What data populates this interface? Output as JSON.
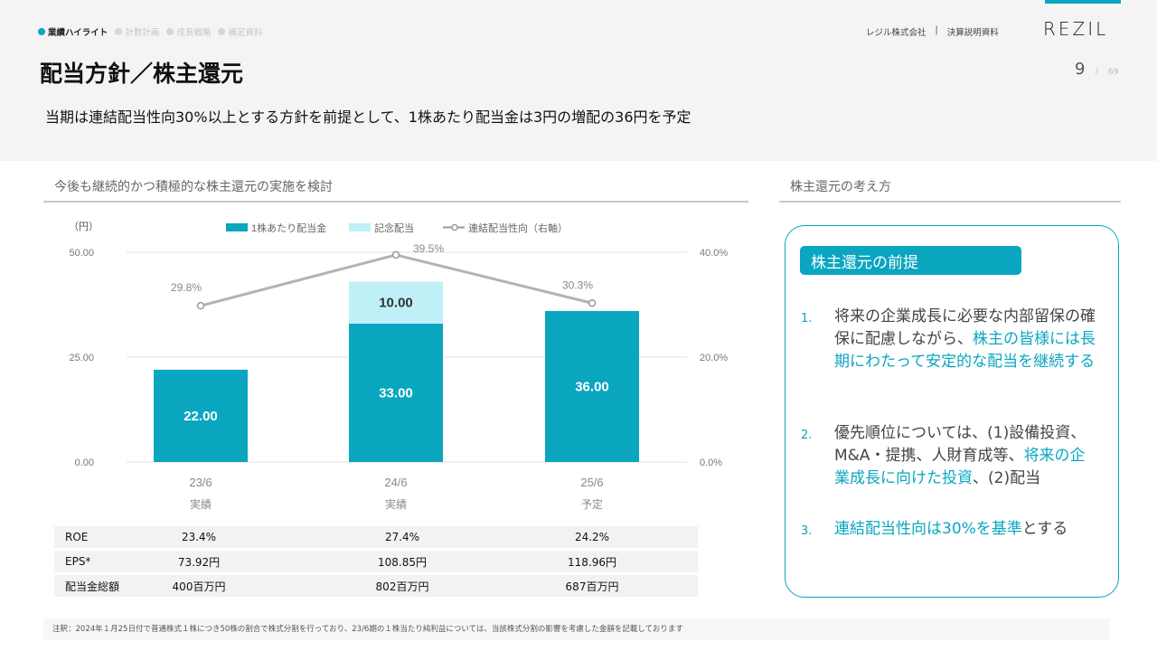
{
  "header": {
    "nav": [
      {
        "label": "業績ハイライト",
        "active": true
      },
      {
        "label": "計数計画",
        "active": false
      },
      {
        "label": "成長戦略",
        "active": false
      },
      {
        "label": "補足資料",
        "active": false
      }
    ],
    "company": "レジル株式会社",
    "separator": "|",
    "doc_type": "決算説明資料",
    "logo": "REZIL",
    "page_number": "9",
    "page_slash": "/",
    "page_total": "69"
  },
  "title": "配当方針／株主還元",
  "lead": "当期は連結配当性向30%以上とする方針を前提として、1株あたり配当金は3円の増配の36円を予定",
  "sections": {
    "left": "今後も継続的かつ積極的な株主還元の実施を検討",
    "right": "株主還元の考え方"
  },
  "chart_data": {
    "type": "bar",
    "categories": [
      "23/6",
      "24/6",
      "25/6"
    ],
    "category_sub": [
      "実績",
      "実績",
      "予定"
    ],
    "y_unit_label": "（円）",
    "series": [
      {
        "name": "1株あたり配当金",
        "values": [
          22.0,
          33.0,
          36.0
        ],
        "labels": [
          "22.00",
          "33.00",
          "36.00"
        ],
        "color": "#0aa6c0"
      },
      {
        "name": "記念配当",
        "values": [
          0,
          10.0,
          0
        ],
        "labels": [
          "",
          "10.00",
          ""
        ],
        "color": "#bff0f7"
      },
      {
        "name": "連結配当性向（右軸）",
        "values": [
          29.8,
          39.5,
          30.3
        ],
        "labels": [
          "29.8%",
          "39.5%",
          "30.3%"
        ],
        "color": "#b3b3b3",
        "axis": "right"
      }
    ],
    "ylim": [
      0,
      50
    ],
    "y_ticks": [
      "0.00",
      "25.00",
      "50.00"
    ],
    "y2lim": [
      0,
      40
    ],
    "y2_ticks": [
      "0.0%",
      "20.0%",
      "40.0%"
    ],
    "grid": true,
    "legend": "top"
  },
  "table": {
    "rows": [
      {
        "label": "ROE",
        "values": [
          "23.4%",
          "27.4%",
          "24.2%"
        ]
      },
      {
        "label": "EPS*",
        "values": [
          "73.92円",
          "108.85円",
          "118.96円"
        ]
      },
      {
        "label": "配当金総額",
        "values": [
          "400百万円",
          "802百万円",
          "687百万円"
        ]
      }
    ]
  },
  "principles": {
    "tag": "株主還元の前提",
    "items": [
      {
        "num": "1.",
        "plain": "将来の企業成長に必要な内部留保の確保に配慮しながら、",
        "highlight": "株主の皆様には長期にわたって安定的な配当を継続する",
        "tail": ""
      },
      {
        "num": "2.",
        "plain": "優先順位については、(1)設備投資、M&A・提携、人財育成等、",
        "highlight": "将来の企業成長に向けた投資",
        "tail": "、(2)配当"
      },
      {
        "num": "3.",
        "plain": "",
        "highlight": "連結配当性向は30%を基準",
        "tail": "とする"
      }
    ]
  },
  "footnote": "注釈：2024年１月25日付で普通株式１株につき50株の割合で株式分割を行っており、23/6期の１株当たり純利益については、当該株式分割の影響を考慮した金額を記載しております"
}
